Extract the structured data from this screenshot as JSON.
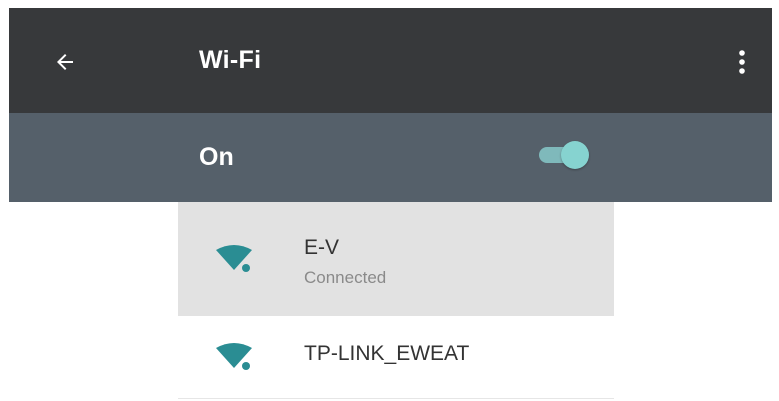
{
  "header": {
    "title": "Wi-Fi",
    "back_icon": "arrow-left-icon",
    "menu_icon": "more-vert-icon",
    "background_color": "#37393b"
  },
  "master_switch": {
    "label": "On",
    "state": "on",
    "background_color": "#55606a",
    "accent_color": "#86d3d0"
  },
  "networks": [
    {
      "ssid": "E-V",
      "status": "Connected",
      "icon": "wifi-signal-icon",
      "icon_color": "#2a8d93"
    },
    {
      "ssid": "TP-LINK_EWEAT",
      "icon": "wifi-signal-icon",
      "icon_color": "#2a8d93"
    }
  ]
}
